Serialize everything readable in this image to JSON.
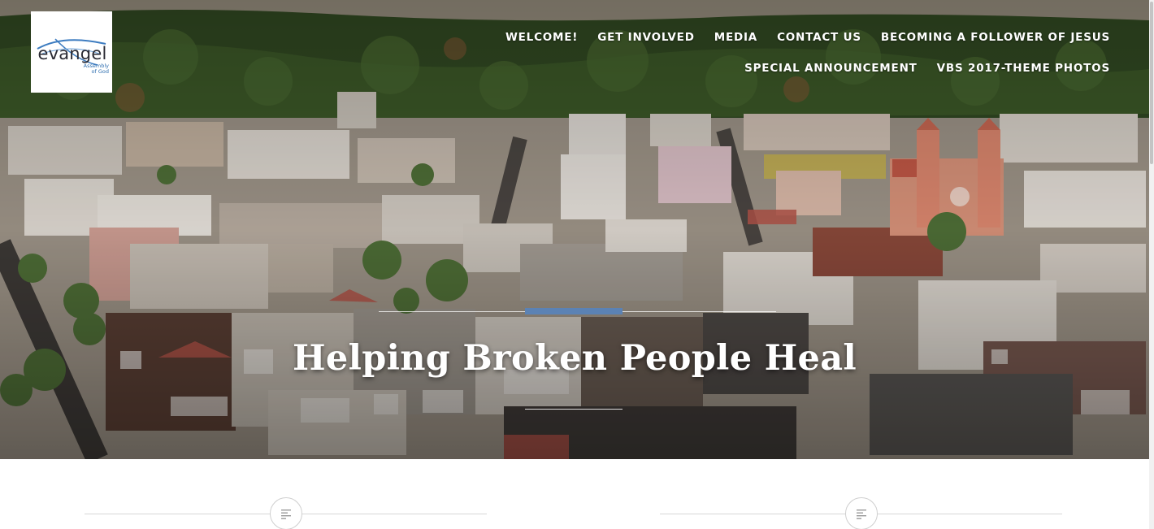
{
  "brand": {
    "name": "evangel",
    "subtitle_line1": "Assembly",
    "subtitle_line2": "of God",
    "accent_color": "#2f6fb0"
  },
  "nav": {
    "items": [
      {
        "label": "WELCOME!"
      },
      {
        "label": "GET INVOLVED"
      },
      {
        "label": "MEDIA"
      },
      {
        "label": "CONTACT US"
      },
      {
        "label": "BECOMING A FOLLOWER OF JESUS"
      },
      {
        "label": "SPECIAL ANNOUNCEMENT"
      },
      {
        "label": "VBS 2017-THEME PHOTOS"
      }
    ]
  },
  "hero": {
    "title": "Helping Broken People Heal",
    "accent_color": "#5b82b4",
    "image_icon": "city-aerial-photo"
  },
  "content": {
    "post_icons": [
      "post-format-standard-icon",
      "post-format-standard-icon"
    ]
  }
}
